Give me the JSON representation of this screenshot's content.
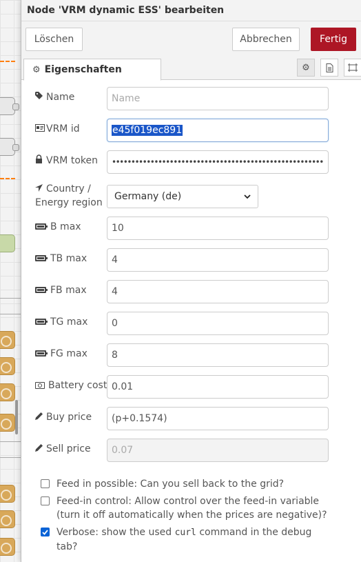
{
  "header": {
    "title": "Node 'VRM dynamic ESS' bearbeiten"
  },
  "toolbar": {
    "delete_label": "Löschen",
    "cancel_label": "Abbrechen",
    "done_label": "Fertig"
  },
  "tabs": {
    "properties_label": "Eigenschaften"
  },
  "fields": {
    "name": {
      "label": "Name",
      "placeholder": "Name",
      "value": ""
    },
    "vrm_id": {
      "label": "VRM id",
      "value": "e45f019ec891"
    },
    "vrm_token": {
      "label": "VRM token",
      "value": "••••••••••••••••••••••••••••••••••••••••••••••••••••••••••••••••"
    },
    "country": {
      "label_line1": "Country /",
      "label_line2": "Energy region",
      "value": "Germany (de)"
    },
    "b_max": {
      "label": "B max",
      "value": "10"
    },
    "tb_max": {
      "label": "TB max",
      "value": "4"
    },
    "fb_max": {
      "label": "FB max",
      "value": "4"
    },
    "tg_max": {
      "label": "TG max",
      "value": "0"
    },
    "fg_max": {
      "label": "FG max",
      "value": "8"
    },
    "battery_costs": {
      "label": "Battery costs",
      "value": "0.01"
    },
    "buy_price": {
      "label": "Buy price",
      "value": "(p+0.1574)"
    },
    "sell_price": {
      "label": "Sell price",
      "value": "0.07"
    }
  },
  "checks": {
    "feed_in_possible": {
      "label": "Feed in possible: Can you sell back to the grid?",
      "checked": false
    },
    "feed_in_control": {
      "label": "Feed-in control: Allow control over the feed-in variable (turn it off automatically when the prices are negative)?",
      "checked": false
    },
    "verbose": {
      "label_before": "Verbose: show the used ",
      "code": "curl",
      "label_after": " command in the debug tab?",
      "checked": true
    }
  },
  "icons": {
    "tag": "tag-icon",
    "id_card": "id-card-icon",
    "lock": "lock-icon",
    "location": "location-arrow-icon",
    "battery": "battery-icon",
    "money": "money-icon",
    "pencil": "pencil-icon",
    "gear": "gear-icon",
    "file": "file-icon",
    "frame": "frame-icon"
  },
  "colors": {
    "primary_button": "#ad1625",
    "selection": "#1a56c8",
    "checkbox_checked": "#0a63d6"
  }
}
